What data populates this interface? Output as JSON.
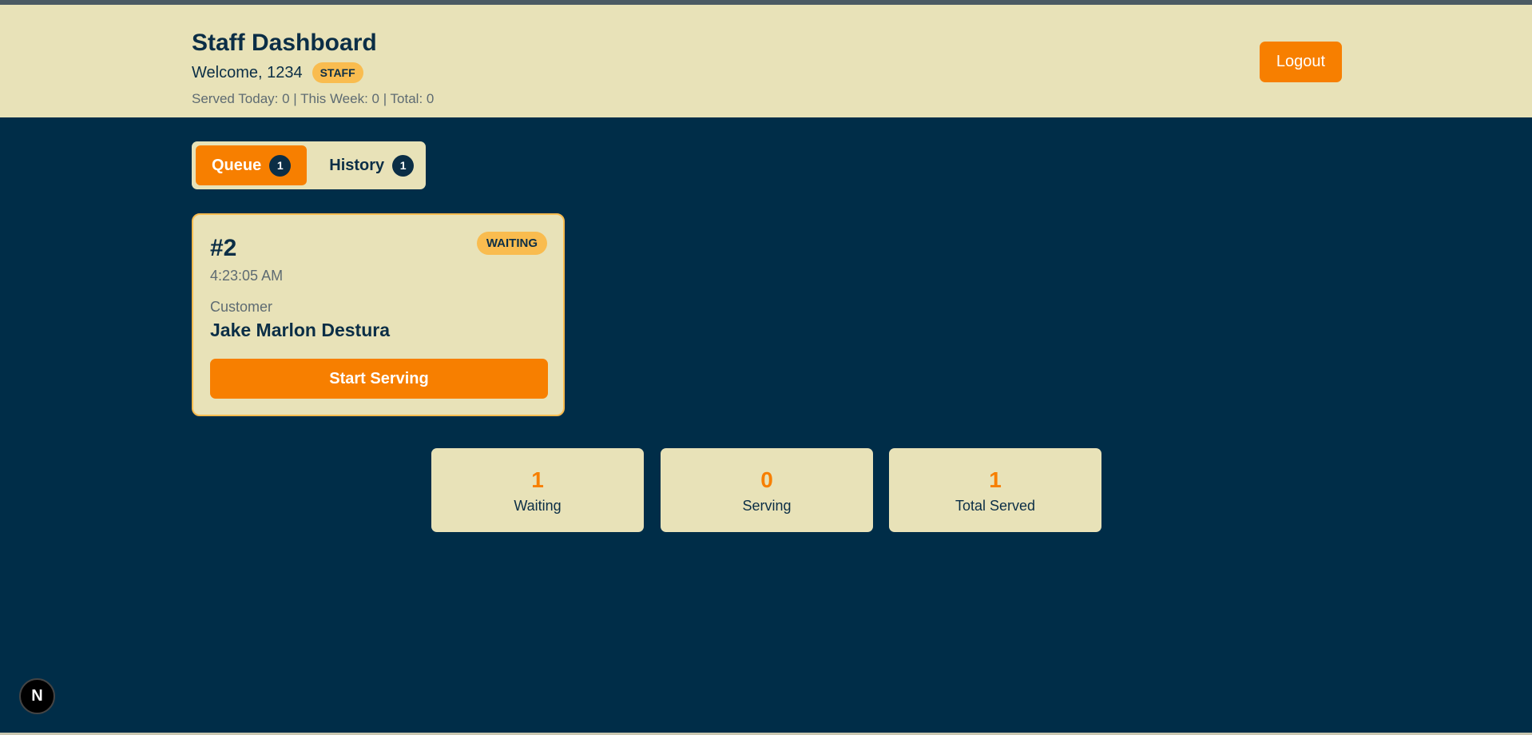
{
  "header": {
    "title": "Staff Dashboard",
    "welcome": "Welcome, 1234",
    "role_badge": "STAFF",
    "stats_line": "Served Today: 0 | This Week: 0 | Total: 0",
    "logout_label": "Logout"
  },
  "tabs": [
    {
      "label": "Queue",
      "count": "1"
    },
    {
      "label": "History",
      "count": "1"
    }
  ],
  "queue_card": {
    "ticket_number": "#2",
    "time": "4:23:05 AM",
    "status": "WAITING",
    "customer_label": "Customer",
    "customer_name": "Jake Marlon Destura",
    "action_label": "Start Serving"
  },
  "stats": [
    {
      "value": "1",
      "label": "Waiting"
    },
    {
      "value": "0",
      "label": "Serving"
    },
    {
      "value": "1",
      "label": "Total Served"
    }
  ],
  "dev_indicator": "N",
  "colors": {
    "background": "#002d48",
    "panel": "#e8e2b8",
    "accent": "#f77f00",
    "badge": "#f9bc4f",
    "text_dark": "#0b2e46"
  }
}
